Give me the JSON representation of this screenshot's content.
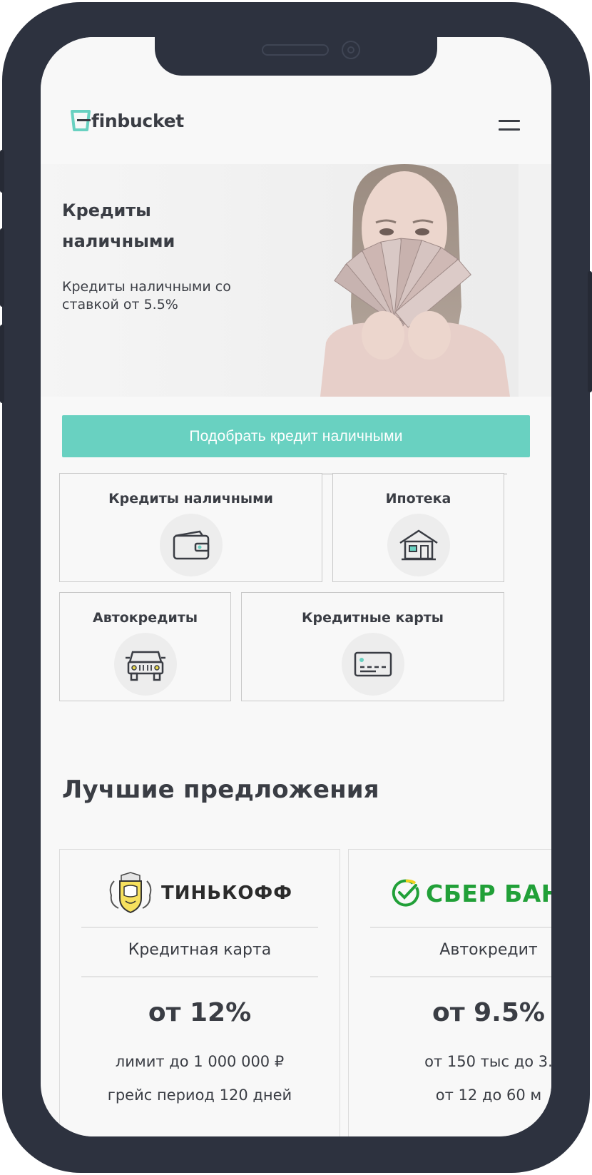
{
  "brand": {
    "name": "finbucket",
    "accent": "#69d1c1",
    "text_color": "#3a3d44"
  },
  "hero": {
    "title": "Кредиты наличными",
    "subtitle": "Кредиты наличными со ставкой от 5.5%"
  },
  "cta": {
    "label": "Подобрать кредит наличными"
  },
  "slider": {
    "dots": 3,
    "active_index": 0
  },
  "categories": [
    {
      "label": "Кредиты наличными",
      "icon": "wallet-icon"
    },
    {
      "label": "Ипотека",
      "icon": "house-icon"
    },
    {
      "label": "Автокредиты",
      "icon": "car-icon"
    },
    {
      "label": "Кредитные карты",
      "icon": "credit-card-icon"
    }
  ],
  "best_offers": {
    "title": "Лучшие предложения",
    "cards": [
      {
        "bank": "ТИНЬКОФФ",
        "product": "Кредитная карта",
        "rate": "от 12%",
        "line1": "лимит до 1 000 000 ₽",
        "line2": "грейс период 120 дней"
      },
      {
        "bank": "СБЕР БАНК",
        "product": "Автокредит",
        "rate": "от 9.5%",
        "line1": "от 150 тыс до 3.",
        "line2": "от 12 до 60 м"
      }
    ]
  }
}
